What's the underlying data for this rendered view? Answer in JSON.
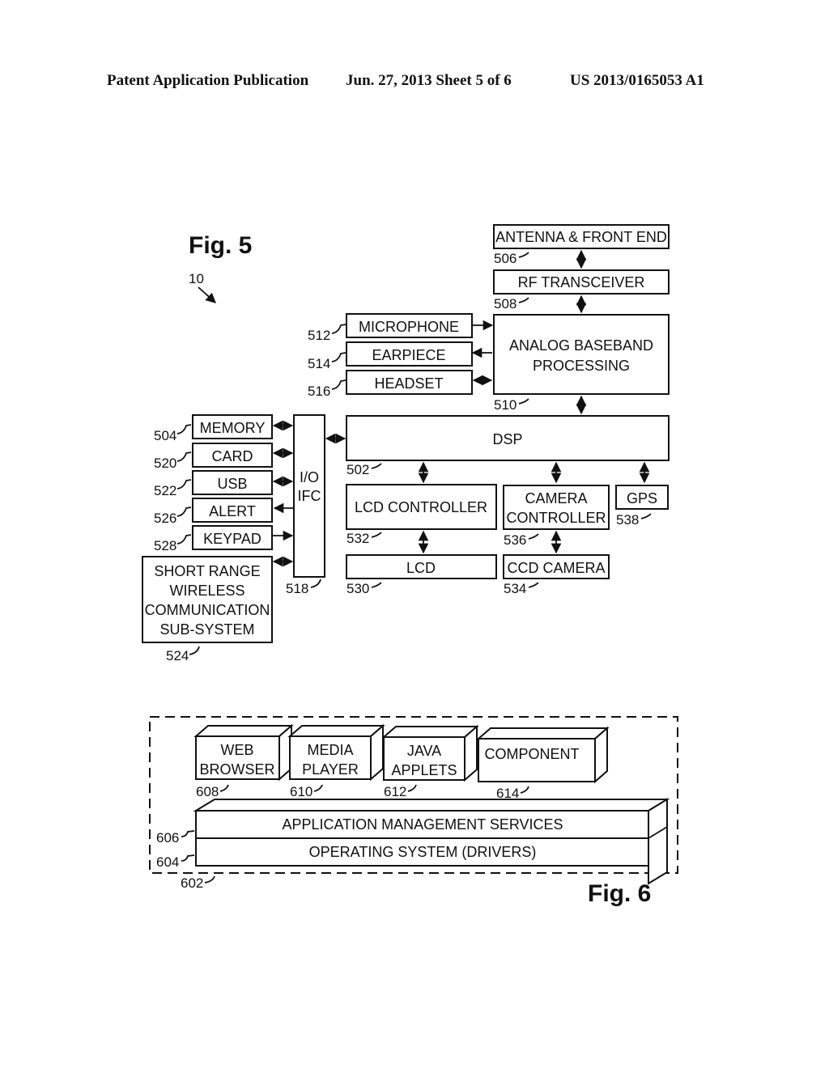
{
  "header": {
    "publication": "Patent Application Publication",
    "date_sheet": "Jun. 27, 2013  Sheet 5 of 6",
    "number": "US 2013/0165053 A1"
  },
  "fig5": {
    "title": "Fig. 5",
    "device_ref": "10",
    "blocks": {
      "antenna": {
        "label": "ANTENNA & FRONT END",
        "ref": "506"
      },
      "rf": {
        "label": "RF TRANSCEIVER",
        "ref": "508"
      },
      "abb": {
        "label1": "ANALOG BASEBAND",
        "label2": "PROCESSING",
        "ref": "510"
      },
      "mic": {
        "label": "MICROPHONE",
        "ref": "512"
      },
      "earpiece": {
        "label": "EARPIECE",
        "ref": "514"
      },
      "headset": {
        "label": "HEADSET",
        "ref": "516"
      },
      "dsp": {
        "label": "DSP",
        "ref": "502"
      },
      "memory": {
        "label": "MEMORY",
        "ref": "504"
      },
      "card": {
        "label": "CARD",
        "ref": "520"
      },
      "usb": {
        "label": "USB",
        "ref": "522"
      },
      "alert": {
        "label": "ALERT",
        "ref": "526"
      },
      "keypad": {
        "label": "KEYPAD",
        "ref": "528"
      },
      "srw": {
        "label1": "SHORT RANGE",
        "label2": "WIRELESS",
        "label3": "COMMUNICATION",
        "label4": "SUB-SYSTEM",
        "ref": "524"
      },
      "io": {
        "label1": "I/O",
        "label2": "IFC",
        "ref": "518"
      },
      "lcdc": {
        "label": "LCD CONTROLLER",
        "ref": "532"
      },
      "camc": {
        "label1": "CAMERA",
        "label2": "CONTROLLER",
        "ref": "536"
      },
      "gps": {
        "label": "GPS",
        "ref": "538"
      },
      "lcd": {
        "label": "LCD",
        "ref": "530"
      },
      "ccd": {
        "label": "CCD CAMERA",
        "ref": "534"
      }
    }
  },
  "fig6": {
    "title": "Fig. 6",
    "container_ref": "602",
    "apps": [
      {
        "line1": "WEB",
        "line2": "BROWSER",
        "ref": "608"
      },
      {
        "line1": "MEDIA",
        "line2": "PLAYER",
        "ref": "610"
      },
      {
        "line1": "JAVA",
        "line2": "APPLETS",
        "ref": "612"
      },
      {
        "line1": "COMPONENT",
        "line2": "",
        "ref": "614"
      }
    ],
    "ams": {
      "label": "APPLICATION MANAGEMENT SERVICES",
      "ref": "606"
    },
    "os": {
      "label": "OPERATING SYSTEM (DRIVERS)",
      "ref": "604"
    }
  }
}
